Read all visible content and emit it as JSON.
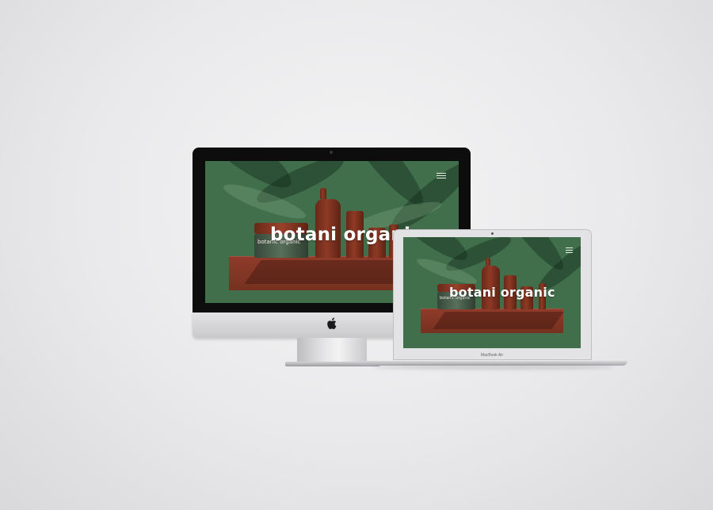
{
  "hero": {
    "brand_title": "botani organic",
    "jar_brand": "botanic organic",
    "menu_icon": "hamburger-menu-icon"
  },
  "devices": {
    "laptop_label": "MacBook Air",
    "desktop_logo_icon": "apple-logo-icon"
  },
  "colors": {
    "background": "#ececee",
    "hero_green": "#416f4b",
    "product_terracotta": "#8e3a25",
    "jar_green": "#4a5f4d"
  }
}
